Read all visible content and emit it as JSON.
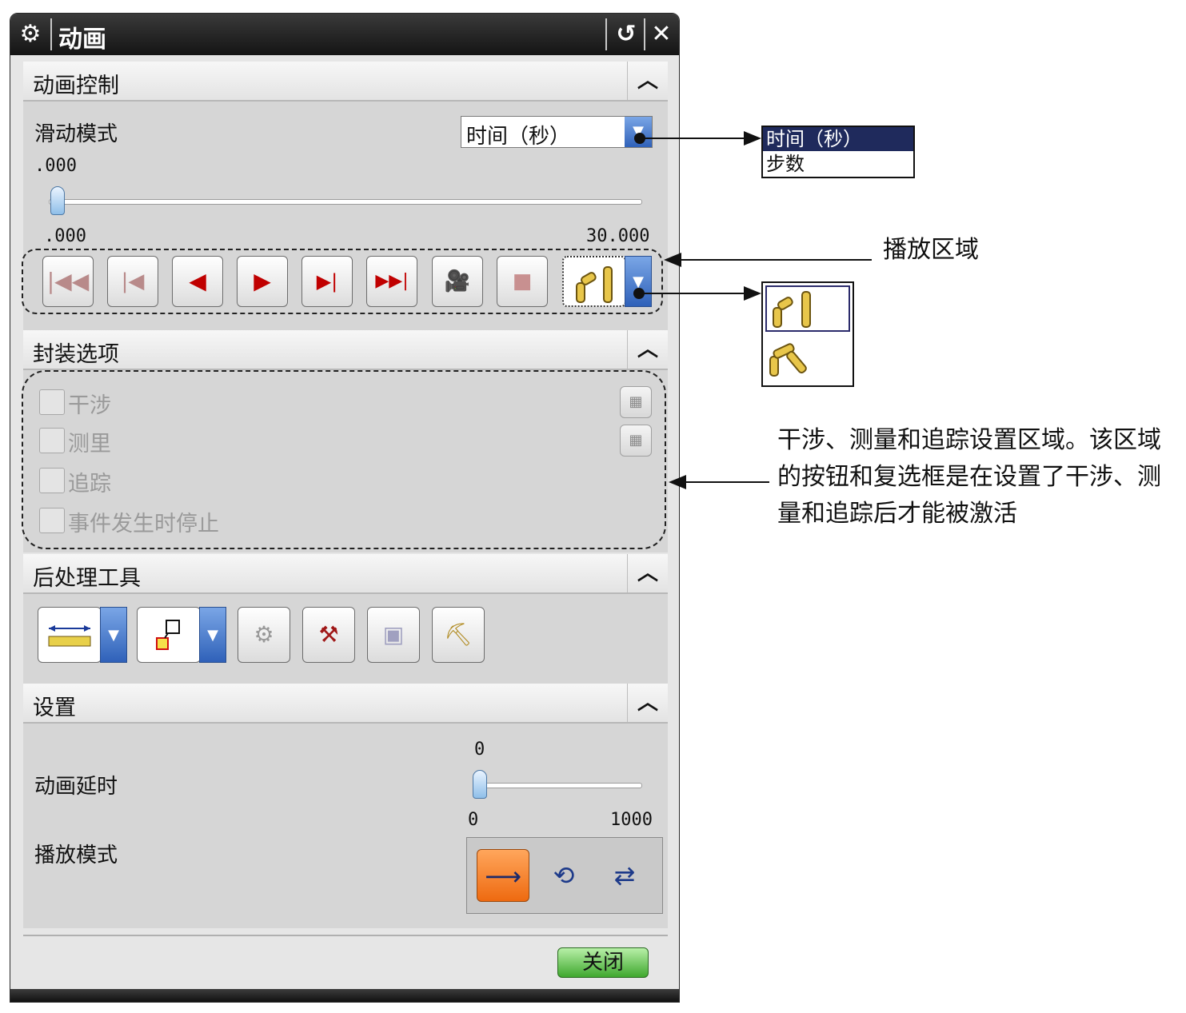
{
  "window": {
    "title": "动画",
    "gear_icon": "⚙",
    "reset_icon": "↺",
    "close_icon": "✕"
  },
  "animation_control": {
    "header": "动画控制",
    "slide_mode_label": "滑动模式",
    "slide_mode_value": "时间（秒）",
    "current_value": ".000",
    "min_value": ".000",
    "max_value": "30.000",
    "slider_fraction": 0.0
  },
  "playback_buttons": [
    {
      "name": "to-start",
      "glyph": "|◀◀"
    },
    {
      "name": "step-back",
      "glyph": "|◀"
    },
    {
      "name": "play-back",
      "glyph": "◀"
    },
    {
      "name": "play-forward",
      "glyph": "▶"
    },
    {
      "name": "step-forward",
      "glyph": "▶|"
    },
    {
      "name": "to-end",
      "glyph": "▶▶|"
    },
    {
      "name": "record",
      "glyph": "🎥"
    },
    {
      "name": "stop",
      "glyph": "■"
    }
  ],
  "packaging": {
    "header": "封装选项",
    "options": [
      "干涉",
      "测里",
      "追踪",
      "事件发生时停止"
    ]
  },
  "post_tools": {
    "header": "后处理工具"
  },
  "settings": {
    "header": "设置",
    "delay_label": "动画延时",
    "delay_current": "0",
    "delay_min": "0",
    "delay_max": "1000",
    "delay_fraction": 0.0,
    "play_mode_label": "播放模式",
    "play_modes": [
      "once",
      "loop",
      "reverse"
    ],
    "active_play_mode": "once"
  },
  "close_label": "关闭",
  "annotations": {
    "dropdown_items": [
      "时间（秒）",
      "步数"
    ],
    "play_area_label": "播放区域",
    "interference_note_lines": [
      "干涉、测量和追踪设置区域。该区域",
      "的按钮和复选框是在设置了干涉、测",
      "量和追踪后才能被激活"
    ]
  },
  "colors": {
    "accent_blue": "#2f61b9",
    "title_bar": "#1a1a1a",
    "active_orange": "#ee6a10",
    "close_green": "#3fa82e",
    "highlight_navy": "#1f2a5c"
  }
}
